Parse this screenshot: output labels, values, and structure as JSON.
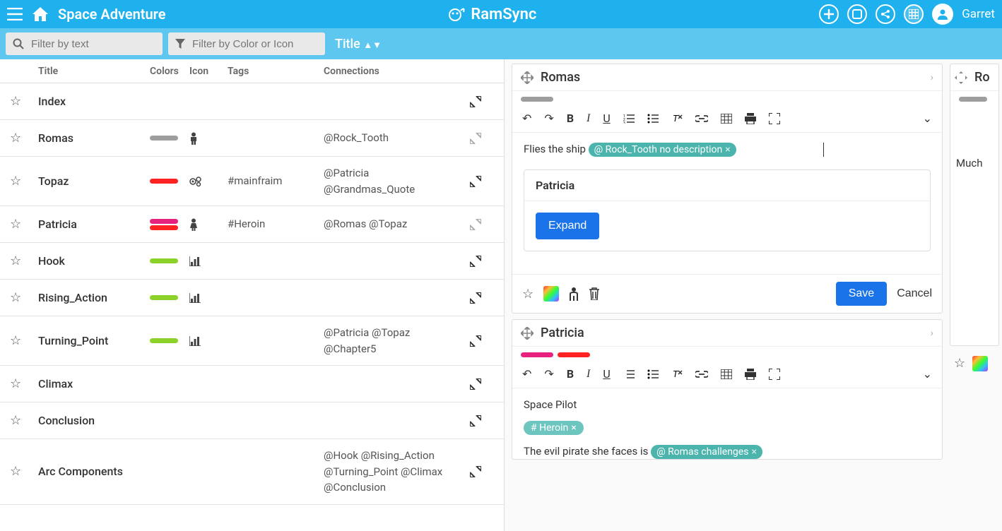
{
  "header": {
    "app_title": "Space Adventure",
    "brand": "RamSync",
    "user": "Garret"
  },
  "filters": {
    "text_ph": "Filter by text",
    "color_ph": "Filter by Color or Icon",
    "sort_label": "Title"
  },
  "columns": {
    "title": "Title",
    "colors": "Colors",
    "icon": "Icon",
    "tags": "Tags",
    "connections": "Connections"
  },
  "rows": [
    {
      "title": "Index",
      "colors": [],
      "icon": "",
      "tags": "",
      "conn": "",
      "exp": "solid"
    },
    {
      "title": "Romas",
      "colors": [
        "#9e9e9e"
      ],
      "icon": "person",
      "tags": "",
      "conn": "@Rock_Tooth",
      "exp": "dim"
    },
    {
      "title": "Topaz",
      "colors": [
        "#f22"
      ],
      "icon": "gears",
      "tags": "#mainfraim",
      "conn": "@Patricia\n@Grandmas_Quote",
      "exp": "solid"
    },
    {
      "title": "Patricia",
      "colors": [
        "#e6217e",
        "#f22"
      ],
      "icon": "person-f",
      "tags": "#Heroin",
      "conn": "@Romas @Topaz",
      "exp": "dim"
    },
    {
      "title": "Hook",
      "colors": [
        "#8bd12a"
      ],
      "icon": "chart",
      "tags": "",
      "conn": "",
      "exp": "solid"
    },
    {
      "title": "Rising_Action",
      "colors": [
        "#8bd12a"
      ],
      "icon": "chart",
      "tags": "",
      "conn": "",
      "exp": "solid"
    },
    {
      "title": "Turning_Point",
      "colors": [
        "#8bd12a"
      ],
      "icon": "chart",
      "tags": "",
      "conn": "@Patricia @Topaz\n@Chapter5",
      "exp": "solid"
    },
    {
      "title": "Climax",
      "colors": [],
      "icon": "",
      "tags": "",
      "conn": "",
      "exp": "solid"
    },
    {
      "title": "Conclusion",
      "colors": [],
      "icon": "",
      "tags": "",
      "conn": "",
      "exp": "solid"
    },
    {
      "title": "Arc Components",
      "colors": [],
      "icon": "",
      "tags": "",
      "conn": "@Hook @Rising_Action\n@Turning_Point @Climax\n@Conclusion",
      "exp": "solid"
    }
  ],
  "card_romas": {
    "title": "Romas",
    "colors": [
      "#9e9e9e"
    ],
    "text_prefix": "Flies the ship ",
    "mention": "@ Rock_Tooth no description",
    "sub_title": "Patricia",
    "expand": "Expand",
    "save": "Save",
    "cancel": "Cancel"
  },
  "card_patricia": {
    "title": "Patricia",
    "colors": [
      "#e6217e",
      "#f22"
    ],
    "line1": "Space Pilot",
    "tag": "# Heroin",
    "line2_prefix": "The evil pirate she faces is ",
    "mention": "@ Romas challenges"
  },
  "card_side": {
    "title_partial": "Ro",
    "text_partial": "Much"
  }
}
